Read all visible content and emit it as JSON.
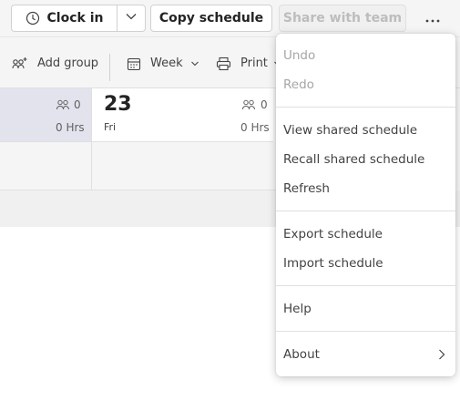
{
  "toolbar": {
    "clock_in_label": "Clock in",
    "copy_schedule_label": "Copy schedule",
    "share_label": "Share with team"
  },
  "subtoolbar": {
    "add_group_label": "Add group",
    "week_label": "Week",
    "print_label": "Print"
  },
  "schedule": {
    "prev_day": {
      "people_count": "0",
      "hours": "0 Hrs"
    },
    "day": {
      "number": "23",
      "name": "Fri",
      "people_count": "0",
      "hours": "0 Hrs"
    }
  },
  "menu": {
    "items": [
      {
        "label": "Undo",
        "enabled": false
      },
      {
        "label": "Redo",
        "enabled": false
      },
      {
        "label": "View shared schedule",
        "enabled": true
      },
      {
        "label": "Recall shared schedule",
        "enabled": true
      },
      {
        "label": "Refresh",
        "enabled": true
      },
      {
        "label": "Export schedule",
        "enabled": true
      },
      {
        "label": "Import schedule",
        "enabled": true
      },
      {
        "label": "Help",
        "enabled": true
      },
      {
        "label": "About",
        "enabled": true,
        "has_submenu": true
      }
    ]
  },
  "colors": {
    "toolbar_bg": "#f5f5f5",
    "selected_day_bg": "#e3e3ee",
    "disabled_text": "#a6a6a6"
  }
}
